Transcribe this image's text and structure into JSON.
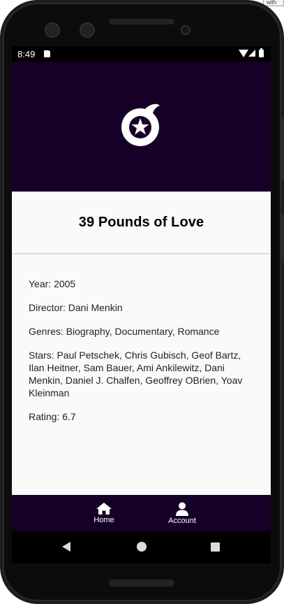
{
  "corner_tab_text": "with",
  "status_bar": {
    "time": "8:49"
  },
  "header": {
    "logo_icon": "star-reel-icon",
    "background_color": "#170028"
  },
  "movie": {
    "title": "39 Pounds of Love",
    "year": "Year: 2005",
    "director": "Director: Dani Menkin",
    "genres": "Genres: Biography, Documentary, Romance",
    "stars": "Stars: Paul Petschek, Chris Gubisch, Geof Bartz, Ilan Heitner, Sam Bauer, Ami Ankilewitz, Dani Menkin, Daniel J. Chalfen, Geoffrey OBrien, Yoav Kleinman",
    "rating": "Rating: 6.7"
  },
  "bottom_nav": {
    "items": [
      {
        "label": "Home",
        "icon": "home-icon"
      },
      {
        "label": "Account",
        "icon": "account-icon"
      }
    ]
  },
  "system_nav": {
    "icons": [
      "back-icon",
      "home-circle-icon",
      "recents-icon"
    ]
  }
}
